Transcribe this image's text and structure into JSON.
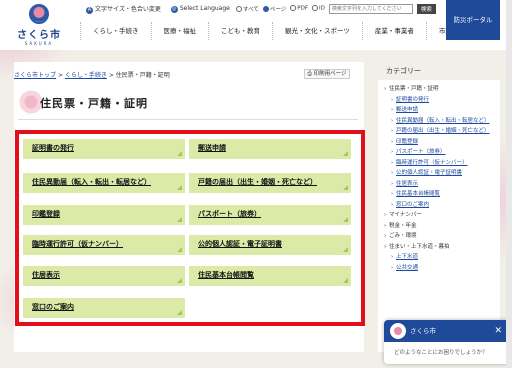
{
  "header": {
    "logo_text": "さくら市",
    "logo_sub": "SAKURA",
    "util_font_color": "文字サイズ・色合い変更",
    "util_language": "Select Language",
    "search_scope": [
      "すべて",
      "ページ",
      "PDF",
      "ID"
    ],
    "search_placeholder": "検索文字列を入力してください",
    "search_button": "検索",
    "bousai_portal": "防災ポータル",
    "gnav": [
      "くらし・手続き",
      "医療・福祉",
      "こども・教育",
      "観光・文化・スポーツ",
      "産業・事業者",
      "市政情報"
    ]
  },
  "breadcrumb": {
    "items": [
      "さくら市トップ",
      "くらし・手続き",
      "住民票・戸籍・証明"
    ]
  },
  "print_button": "印刷用ページ",
  "page_title": "住民票・戸籍・証明",
  "items": [
    "証明書の発行",
    "郵送申請",
    "住民異動届（転入・転出・転居など）",
    "戸籍の届出（出生・婚姻・死亡など）",
    "印鑑登録",
    "パスポート（旅券）",
    "臨時運行許可（仮ナンバー）",
    "公的個人認証・電子証明書",
    "住居表示",
    "住民基本台帳閲覧",
    "窓口のご案内"
  ],
  "sidebar": {
    "heading": "カテゴリー",
    "top_item": "住民票・戸籍・証明",
    "items": [
      "証明書の発行",
      "郵送申請",
      "住民異動届（転入・転出・転居など）",
      "戸籍の届出（出生・婚姻・死亡など）",
      "印鑑登録",
      "パスポート（旅券）",
      "臨時運行許可（仮ナンバー）",
      "公的個人認証・電子証明書",
      "住居表示",
      "住民基本台帳閲覧",
      "窓口のご案内"
    ],
    "after": [
      "マイナンバー",
      "税金・年金",
      "ごみ・環境",
      "住まい・上下水道・暮拍",
      "上下水道",
      "公共交通"
    ]
  },
  "chat": {
    "title": "さくら市",
    "message": "どのようなことにお困りでしょうか？"
  },
  "colors": {
    "accent": "#1f4a9a",
    "item_bg": "#dbeaa7",
    "highlight_border": "#e3101a"
  }
}
